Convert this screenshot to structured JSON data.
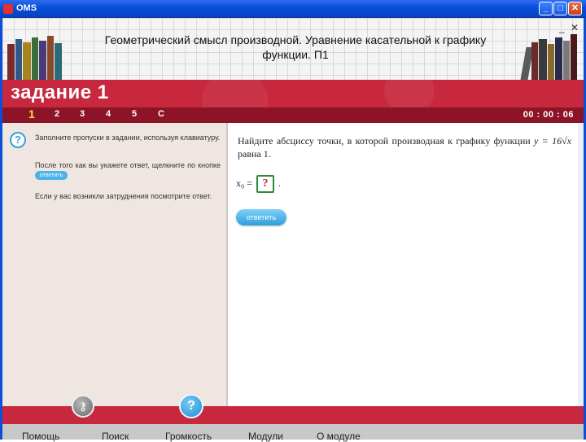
{
  "window": {
    "title": "OMS",
    "min_label": "_",
    "max_label": "□",
    "close_label": "✕"
  },
  "header": {
    "title_line1": "Геометрический смысл производной. Уравнение касательной к графику",
    "title_line2": "функции. П1",
    "min_label": "_",
    "close_label": "✕"
  },
  "task": {
    "title": "задание 1"
  },
  "nav": {
    "items": [
      "1",
      "2",
      "3",
      "4",
      "5",
      "C"
    ],
    "active_index": 0,
    "timer": "00 : 00 : 06"
  },
  "help": {
    "hint1": "Заполните пропуски в задании, используя клавиатуру.",
    "hint2": "После того как вы укажете ответ, щелкните по кнопке",
    "hint2_button": "ответить",
    "hint3": "Если у вас возникли затруднения посмотрите ответ."
  },
  "question": {
    "text": "Найдите абсциссу точки, в которой производная к графику функции",
    "function": "y = 16√x",
    "tail": "равна 1.",
    "answer_prefix": "x₀ =",
    "answer_placeholder": "?",
    "answer_suffix": ".",
    "submit_label": "ответить"
  },
  "bottom": {
    "key_icon": "key-icon",
    "help_icon_label": "?"
  },
  "footer": {
    "items": [
      "Помощь",
      "Поиск",
      "Громкость",
      "Модули",
      "О модуле"
    ]
  },
  "colors": {
    "banner": "#c8283e",
    "navbar": "#8c1426",
    "panel": "#efe6e1",
    "accent": "#3a9fdc"
  }
}
